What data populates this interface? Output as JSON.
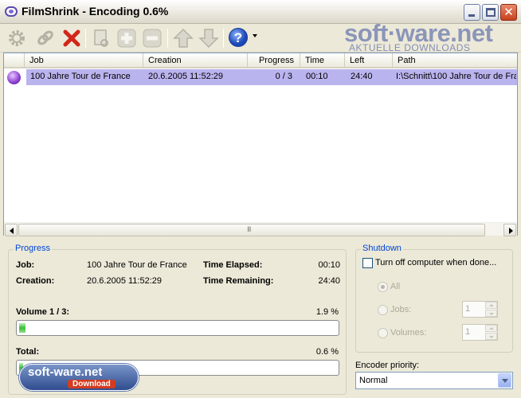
{
  "window": {
    "title": "FilmShrink - Encoding 0.6%",
    "close_glyph": "✕"
  },
  "watermark": {
    "top_main": "soft·ware.net",
    "top_sub": "AKTUELLE DOWNLOADS",
    "bottom_main": "soft-ware.net",
    "bottom_sub": "Download"
  },
  "list": {
    "columns": [
      "Job",
      "Creation",
      "Progress",
      "Time",
      "Left",
      "Path"
    ],
    "rows": [
      {
        "job": "100 Jahre Tour de France",
        "creation": "20.6.2005 11:52:29",
        "progress": "0 / 3",
        "time": "00:10",
        "left": "24:40",
        "path": "I:\\Schnitt\\100 Jahre Tour de France"
      }
    ],
    "scroll_grip": "III"
  },
  "progress": {
    "title": "Progress",
    "job_label": "Job:",
    "job_value": "100 Jahre Tour de France",
    "creation_label": "Creation:",
    "creation_value": "20.6.2005 11:52:29",
    "elapsed_label": "Time Elapsed:",
    "elapsed_value": "00:10",
    "remaining_label": "Time Remaining:",
    "remaining_value": "24:40",
    "volume_label": "Volume 1 / 3:",
    "volume_percent": "1.9 %",
    "volume_fraction": 0.019,
    "total_label": "Total:",
    "total_percent": "0.6 %",
    "total_fraction": 0.006
  },
  "shutdown": {
    "title": "Shutdown",
    "checkbox_label": "Turn off computer when done...",
    "radio_all": "All",
    "radio_jobs": "Jobs:",
    "radio_volumes": "Volumes:",
    "jobs_value": "1",
    "volumes_value": "1"
  },
  "priority": {
    "label": "Encoder priority:",
    "value": "Normal"
  },
  "colors": {
    "selection": "#b9b4ee",
    "group_title": "#0046d5",
    "progress_green": "#3bbd3b"
  }
}
